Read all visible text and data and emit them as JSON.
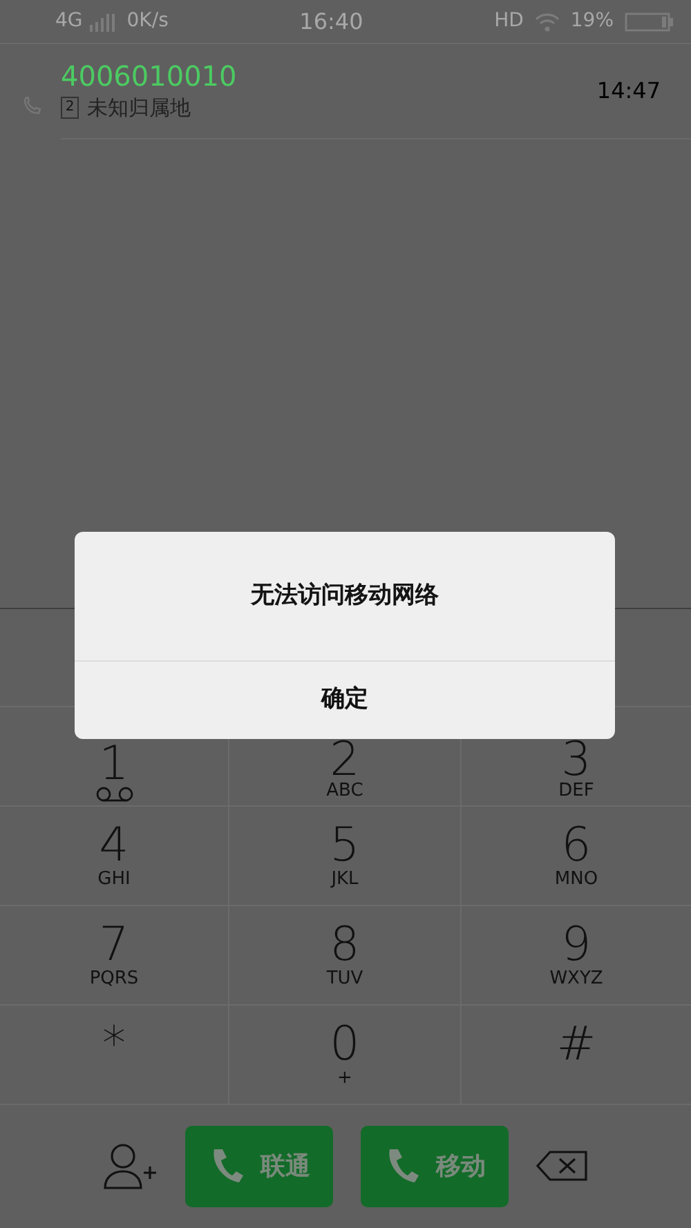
{
  "status_bar": {
    "network": "4G",
    "speed": "0K/s",
    "time": "16:40",
    "hd": "HD",
    "battery": "19%"
  },
  "call_log": [
    {
      "number": "4006010010",
      "sim": "2",
      "location": "未知归属地",
      "time": "14:47"
    }
  ],
  "keypad": [
    {
      "kind": "voicemail",
      "digit": "1"
    },
    {
      "kind": "letters",
      "digit": "2",
      "letters": "ABC"
    },
    {
      "kind": "letters",
      "digit": "3",
      "letters": "DEF"
    },
    {
      "kind": "letters",
      "digit": "4",
      "letters": "GHI"
    },
    {
      "kind": "letters",
      "digit": "5",
      "letters": "JKL"
    },
    {
      "kind": "letters",
      "digit": "6",
      "letters": "MNO"
    },
    {
      "kind": "letters",
      "digit": "7",
      "letters": "PQRS"
    },
    {
      "kind": "letters",
      "digit": "8",
      "letters": "TUV"
    },
    {
      "kind": "letters",
      "digit": "9",
      "letters": "WXYZ"
    },
    {
      "kind": "symbol",
      "digit": "*"
    },
    {
      "kind": "letters",
      "digit": "0",
      "letters": "+"
    },
    {
      "kind": "symbol",
      "digit": "#"
    }
  ],
  "call_buttons": [
    {
      "label": "联通"
    },
    {
      "label": "移动"
    }
  ],
  "dialog": {
    "message": "无法访问移动网络",
    "button": "确定"
  }
}
